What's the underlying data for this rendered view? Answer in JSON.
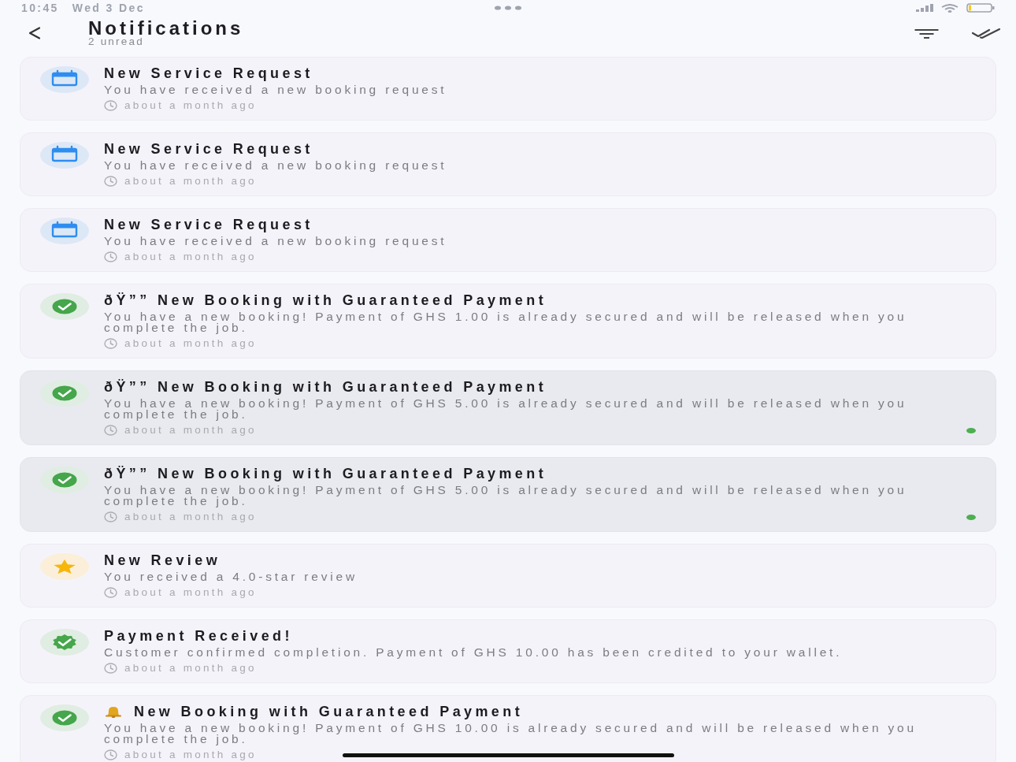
{
  "status_bar": {
    "time": "10:45",
    "date": "Wed 3 Dec"
  },
  "header": {
    "title": "Notifications",
    "subtitle": "2 unread"
  },
  "notifications": [
    {
      "kind": "calendar",
      "title_icon": false,
      "title": "New Service Request",
      "message": "You have received a new booking request",
      "time": "about a month ago",
      "unread": false
    },
    {
      "kind": "calendar",
      "title_icon": false,
      "title": "New Service Request",
      "message": "You have received a new booking request",
      "time": "about a month ago",
      "unread": false
    },
    {
      "kind": "calendar",
      "title_icon": false,
      "title": "New Service Request",
      "message": "You have received a new booking request",
      "time": "about a month ago",
      "unread": false
    },
    {
      "kind": "check",
      "title_icon": false,
      "title": "ðŸ”” New Booking with Guaranteed Payment",
      "message": "You have a new booking! Payment of GHS 1.00 is already secured and will be released when you complete the job.",
      "time": "about a month ago",
      "unread": false
    },
    {
      "kind": "check",
      "title_icon": false,
      "title": "ðŸ”” New Booking with Guaranteed Payment",
      "message": "You have a new booking! Payment of GHS 5.00 is already secured and will be released when you complete the job.",
      "time": "about a month ago",
      "unread": true
    },
    {
      "kind": "check",
      "title_icon": false,
      "title": "ðŸ”” New Booking with Guaranteed Payment",
      "message": "You have a new booking! Payment of GHS 5.00 is already secured and will be released when you complete the job.",
      "time": "about a month ago",
      "unread": true
    },
    {
      "kind": "star",
      "title_icon": false,
      "title": "New Review",
      "message": "You received a 4.0-star review",
      "time": "about a month ago",
      "unread": false
    },
    {
      "kind": "badge",
      "title_icon": false,
      "title": "Payment Received!",
      "message": "Customer confirmed completion. Payment of GHS 10.00 has been credited to your wallet.",
      "time": "about a month ago",
      "unread": false
    },
    {
      "kind": "check",
      "title_icon": true,
      "title": "New Booking with Guaranteed Payment",
      "message": "You have a new booking! Payment of GHS 10.00 is already secured and will be released when you complete the job.",
      "time": "about a month ago",
      "unread": false
    }
  ]
}
